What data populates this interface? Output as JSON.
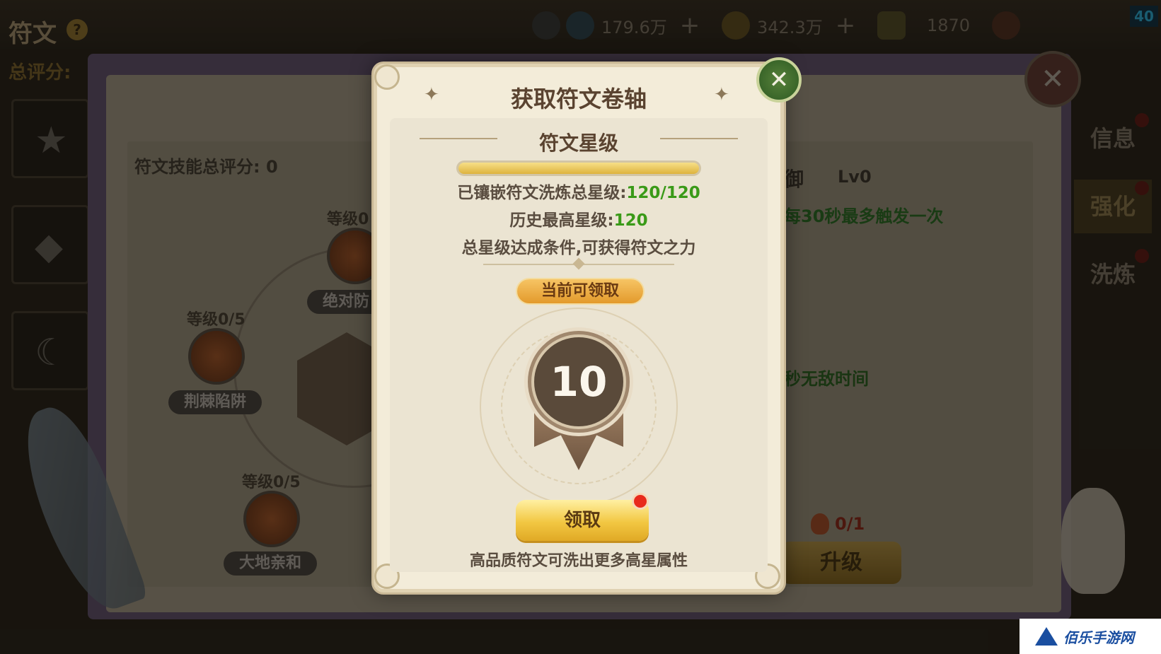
{
  "header": {
    "page_title": "符文",
    "help_icon": "?",
    "resources": [
      {
        "icon": "blue-crystal-icon",
        "value": "179.6万"
      },
      {
        "icon": "gold-coin-icon",
        "value": "342.3万"
      },
      {
        "icon": "gem-icon",
        "value": "1870"
      }
    ],
    "plus_label": "+",
    "fps": "40"
  },
  "background": {
    "score_label": "总评分:",
    "rune_skill_total": "符文技能总评分: 0",
    "nodes": [
      {
        "level": "等级0",
        "name": "绝对防"
      },
      {
        "level": "等级0/5",
        "name": "荆棘陷阱"
      },
      {
        "level": "等级0/5",
        "name": "大地亲和"
      }
    ],
    "right_title": "御",
    "right_level": "Lv0",
    "right_desc": "每30秒最多触发一次",
    "right_desc2": "秒无敌时间",
    "cost": "0/1",
    "upgrade_label": "升级",
    "side_tabs": [
      "信息",
      "强化",
      "洗炼"
    ]
  },
  "modal": {
    "title": "获取符文卷轴",
    "section_title": "符文星级",
    "progress": 1.0,
    "total_label": "已镶嵌符文洗炼总星级:",
    "total_value": "120/120",
    "history_label": "历史最高星级:",
    "history_value": "120",
    "condition_text": "总星级达成条件,可获得符文之力",
    "claimable_label": "当前可领取",
    "medal_value": "10",
    "claim_label": "领取",
    "hint": "高品质符文可洗出更多高星属性",
    "close_icon": "✕"
  },
  "watermark": "佰乐手游网",
  "colors": {
    "accent_green": "#3a9a18",
    "gold_button": "#f2c742",
    "badge_red": "#e82a1c"
  }
}
